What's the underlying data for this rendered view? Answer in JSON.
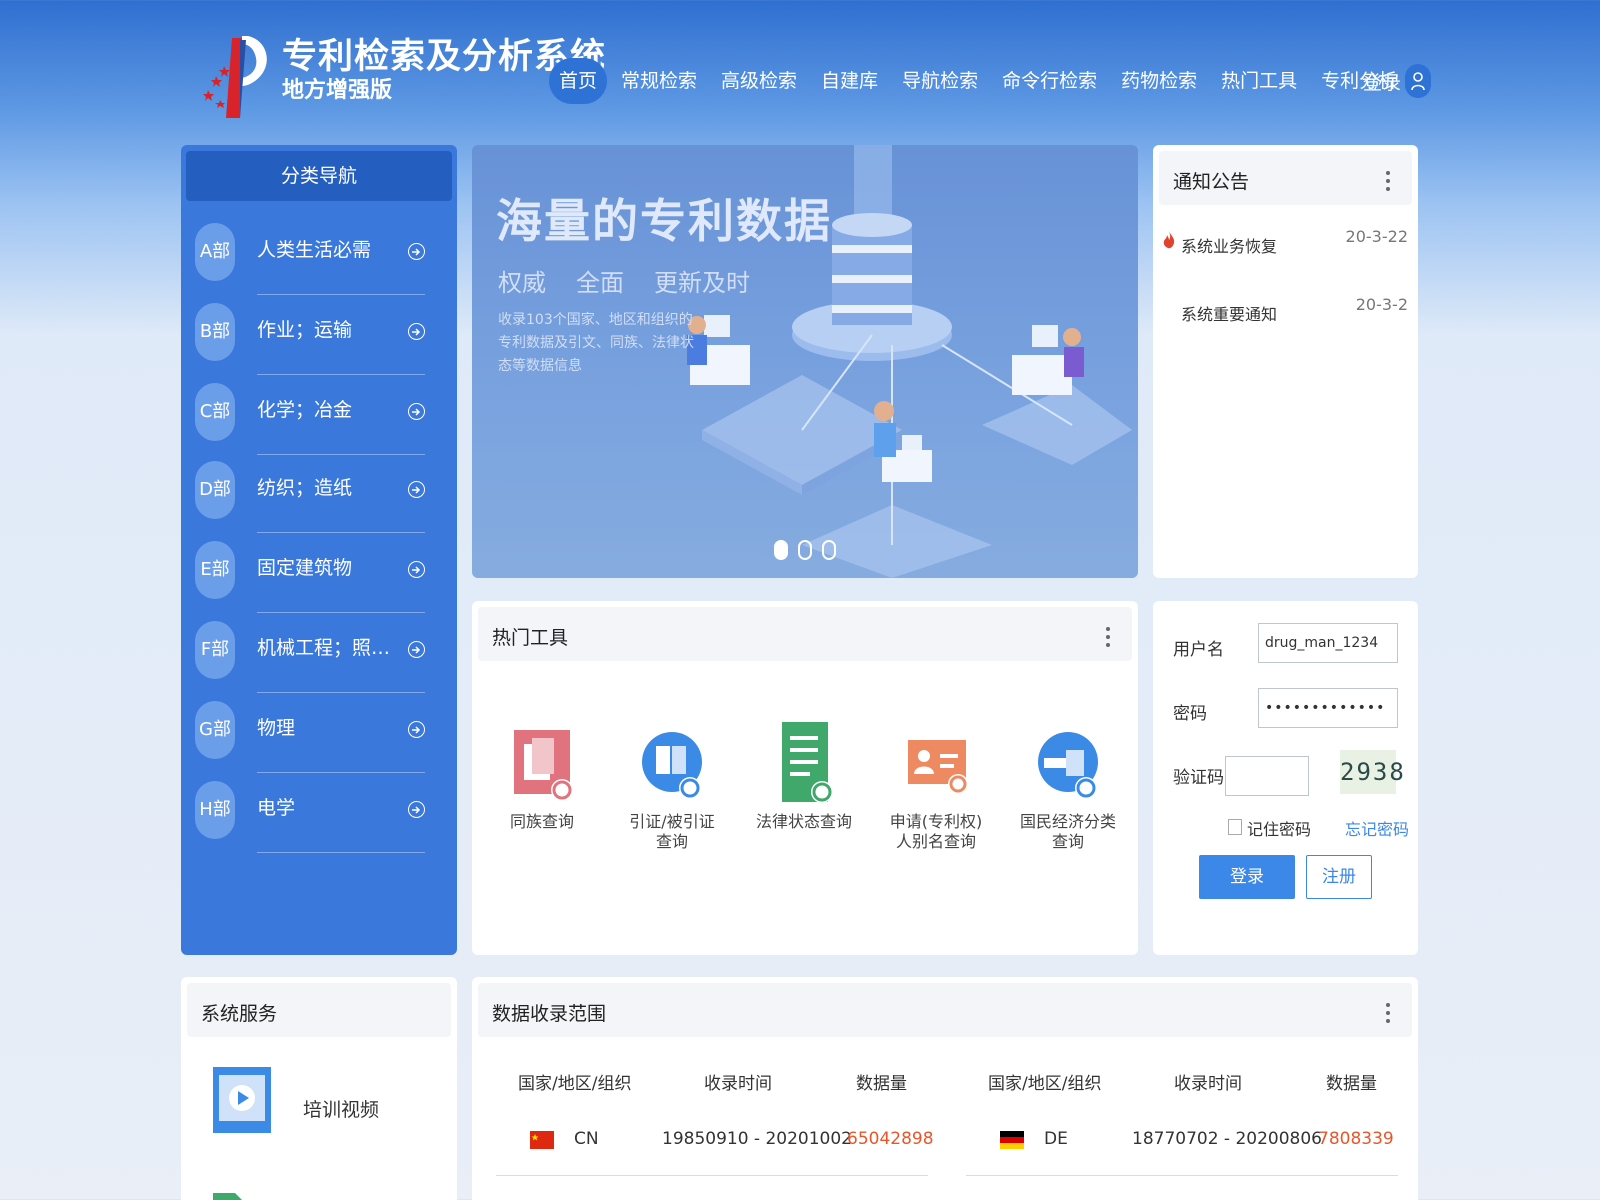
{
  "header": {
    "title": "专利检索及分析系统",
    "subtitle": "地方增强版",
    "nav": [
      "首页",
      "常规检索",
      "高级检索",
      "自建库",
      "导航检索",
      "命令行检索",
      "药物检索",
      "热门工具",
      "专利分析"
    ],
    "active_nav": 0,
    "login_label": "登录"
  },
  "sidebar": {
    "title": "分类导航",
    "items": [
      {
        "badge": "A部",
        "label": "人类生活必需"
      },
      {
        "badge": "B部",
        "label": "作业；运输"
      },
      {
        "badge": "C部",
        "label": "化学；冶金"
      },
      {
        "badge": "D部",
        "label": "纺织；造纸"
      },
      {
        "badge": "E部",
        "label": "固定建筑物"
      },
      {
        "badge": "F部",
        "label": "机械工程；照明；…"
      },
      {
        "badge": "G部",
        "label": "物理"
      },
      {
        "badge": "H部",
        "label": "电学"
      }
    ]
  },
  "banner": {
    "title": "海量的专利数据",
    "tags": [
      "权威",
      "全面",
      "更新及时"
    ],
    "desc": "收录103个国家、地区和组织的专利数据及引文、同族、法律状态等数据信息",
    "slide_count": 3,
    "active_slide": 0
  },
  "notice": {
    "title": "通知公告",
    "items": [
      {
        "text": "系统业务恢复",
        "date": "20-3-22",
        "hot": true
      },
      {
        "text": "系统重要通知",
        "date": "20-3-2",
        "hot": false
      }
    ]
  },
  "tools": {
    "title": "热门工具",
    "items": [
      {
        "label": "同族查询",
        "icon": "family-search-icon",
        "color": "#e0737d"
      },
      {
        "label": "引证/被引证查询",
        "icon": "citation-search-icon",
        "color": "#3b8be6"
      },
      {
        "label": "法律状态查询",
        "icon": "legal-status-icon",
        "color": "#3fa86a"
      },
      {
        "label": "申请(专利权)人别名查询",
        "icon": "applicant-alias-icon",
        "color": "#ee8a62"
      },
      {
        "label": "国民经济分类查询",
        "icon": "economy-classification-icon",
        "color": "#3b8be6"
      }
    ]
  },
  "login": {
    "username_label": "用户名",
    "username_value": "drug_man_1234",
    "password_label": "密码",
    "password_value": "•••••••••••••",
    "captcha_label": "验证码",
    "captcha_value": "",
    "captcha_text": "2938",
    "remember_label": "记住密码",
    "forgot_label": "忘记密码",
    "login_button": "登录",
    "register_button": "注册"
  },
  "services": {
    "title": "系统服务",
    "items": [
      {
        "label": "培训视频",
        "icon": "video-icon"
      }
    ]
  },
  "data_range": {
    "title": "数据收录范围",
    "columns": [
      "国家/地区/组织",
      "收录时间",
      "数据量"
    ],
    "left_rows": [
      {
        "country": "CN",
        "flag": "cn-flag-icon",
        "period": "19850910 - 20201002",
        "count": "65042898"
      }
    ],
    "right_rows": [
      {
        "country": "DE",
        "flag": "de-flag-icon",
        "period": "18770702 - 20200806",
        "count": "7808339"
      }
    ]
  }
}
